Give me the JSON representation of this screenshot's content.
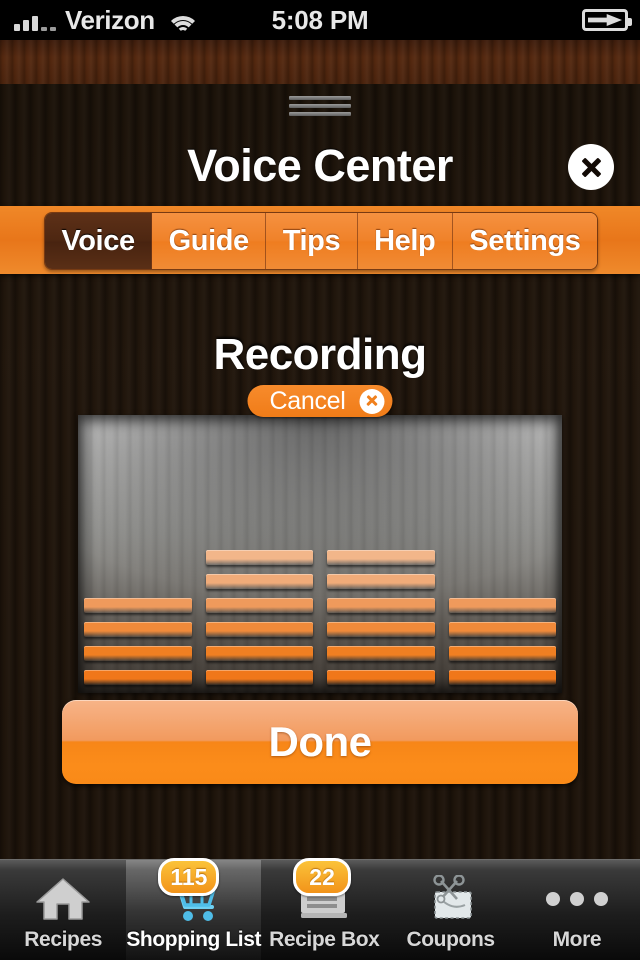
{
  "statusbar": {
    "carrier": "Verizon",
    "time": "5:08 PM",
    "signal_icon": "signal-bars-icon",
    "wifi_icon": "wifi-icon",
    "battery_icon": "battery-charging-icon"
  },
  "header": {
    "title": "Voice Center",
    "close_icon": "close-icon",
    "drag_handle_icon": "drag-handle-icon"
  },
  "tabs": {
    "items": [
      {
        "label": "Voice",
        "selected": true
      },
      {
        "label": "Guide",
        "selected": false
      },
      {
        "label": "Tips",
        "selected": false
      },
      {
        "label": "Help",
        "selected": false
      },
      {
        "label": "Settings",
        "selected": false
      }
    ]
  },
  "recording": {
    "title": "Recording",
    "cancel_label": "Cancel",
    "cancel_icon": "circle-x-icon",
    "done_label": "Done"
  },
  "meter": {
    "columns": [
      4,
      6,
      6,
      4
    ],
    "max_segments": 6,
    "segment_colors_bottom_to_top": [
      "#f0771a",
      "#f07f22",
      "#f08a3a",
      "#ef9a5c",
      "#f0ab79",
      "#f2b68a"
    ]
  },
  "tabbar": {
    "items": [
      {
        "label": "Recipes",
        "icon": "home-icon",
        "badge": null,
        "selected": false
      },
      {
        "label": "Shopping List",
        "icon": "shopping-cart-icon",
        "badge": "115",
        "selected": true
      },
      {
        "label": "Recipe Box",
        "icon": "recipe-card-icon",
        "badge": "22",
        "selected": false
      },
      {
        "label": "Coupons",
        "icon": "scissors-coupon-icon",
        "badge": null,
        "selected": false
      },
      {
        "label": "More",
        "icon": "ellipsis-icon",
        "badge": null,
        "selected": false
      }
    ]
  },
  "colors": {
    "accent_orange": "#f0801d",
    "tab_selected_brown": "#4e2712",
    "badge_gold": "#f2931a",
    "cart_blue": "#5fc9ef"
  }
}
